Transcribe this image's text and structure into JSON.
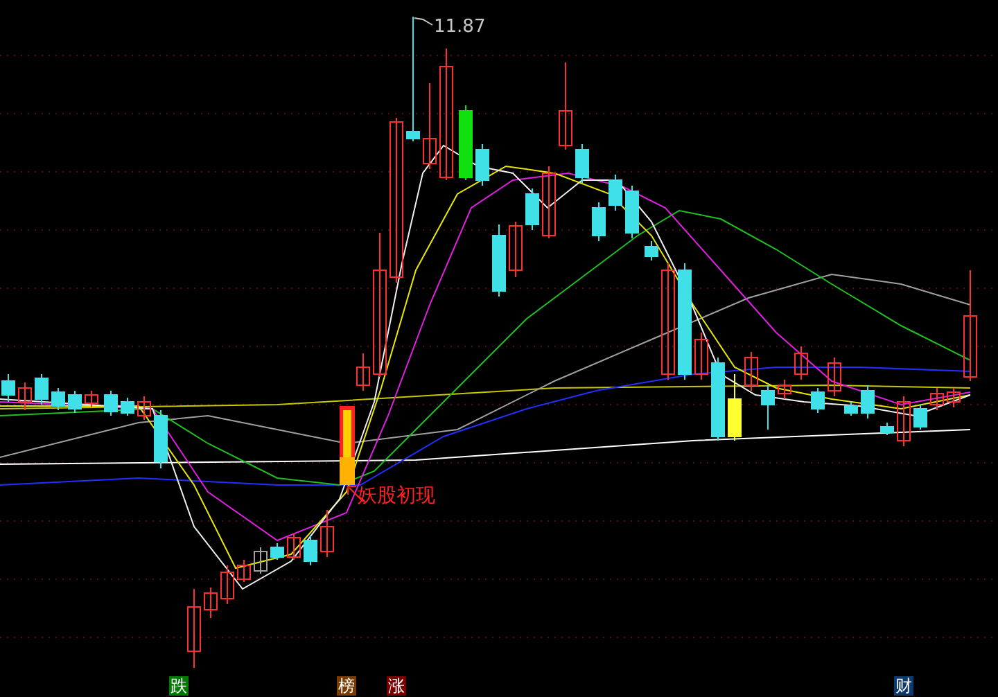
{
  "chart": {
    "peak_label": "11.87",
    "signal_label": "妖股初现"
  },
  "markers": [
    {
      "label": "跌",
      "color": "#007a00"
    },
    {
      "label": "榜",
      "color": "#7a3a00"
    },
    {
      "label": "涨",
      "color": "#7a0000"
    },
    {
      "label": "财",
      "color": "#0a3a6e"
    }
  ]
}
